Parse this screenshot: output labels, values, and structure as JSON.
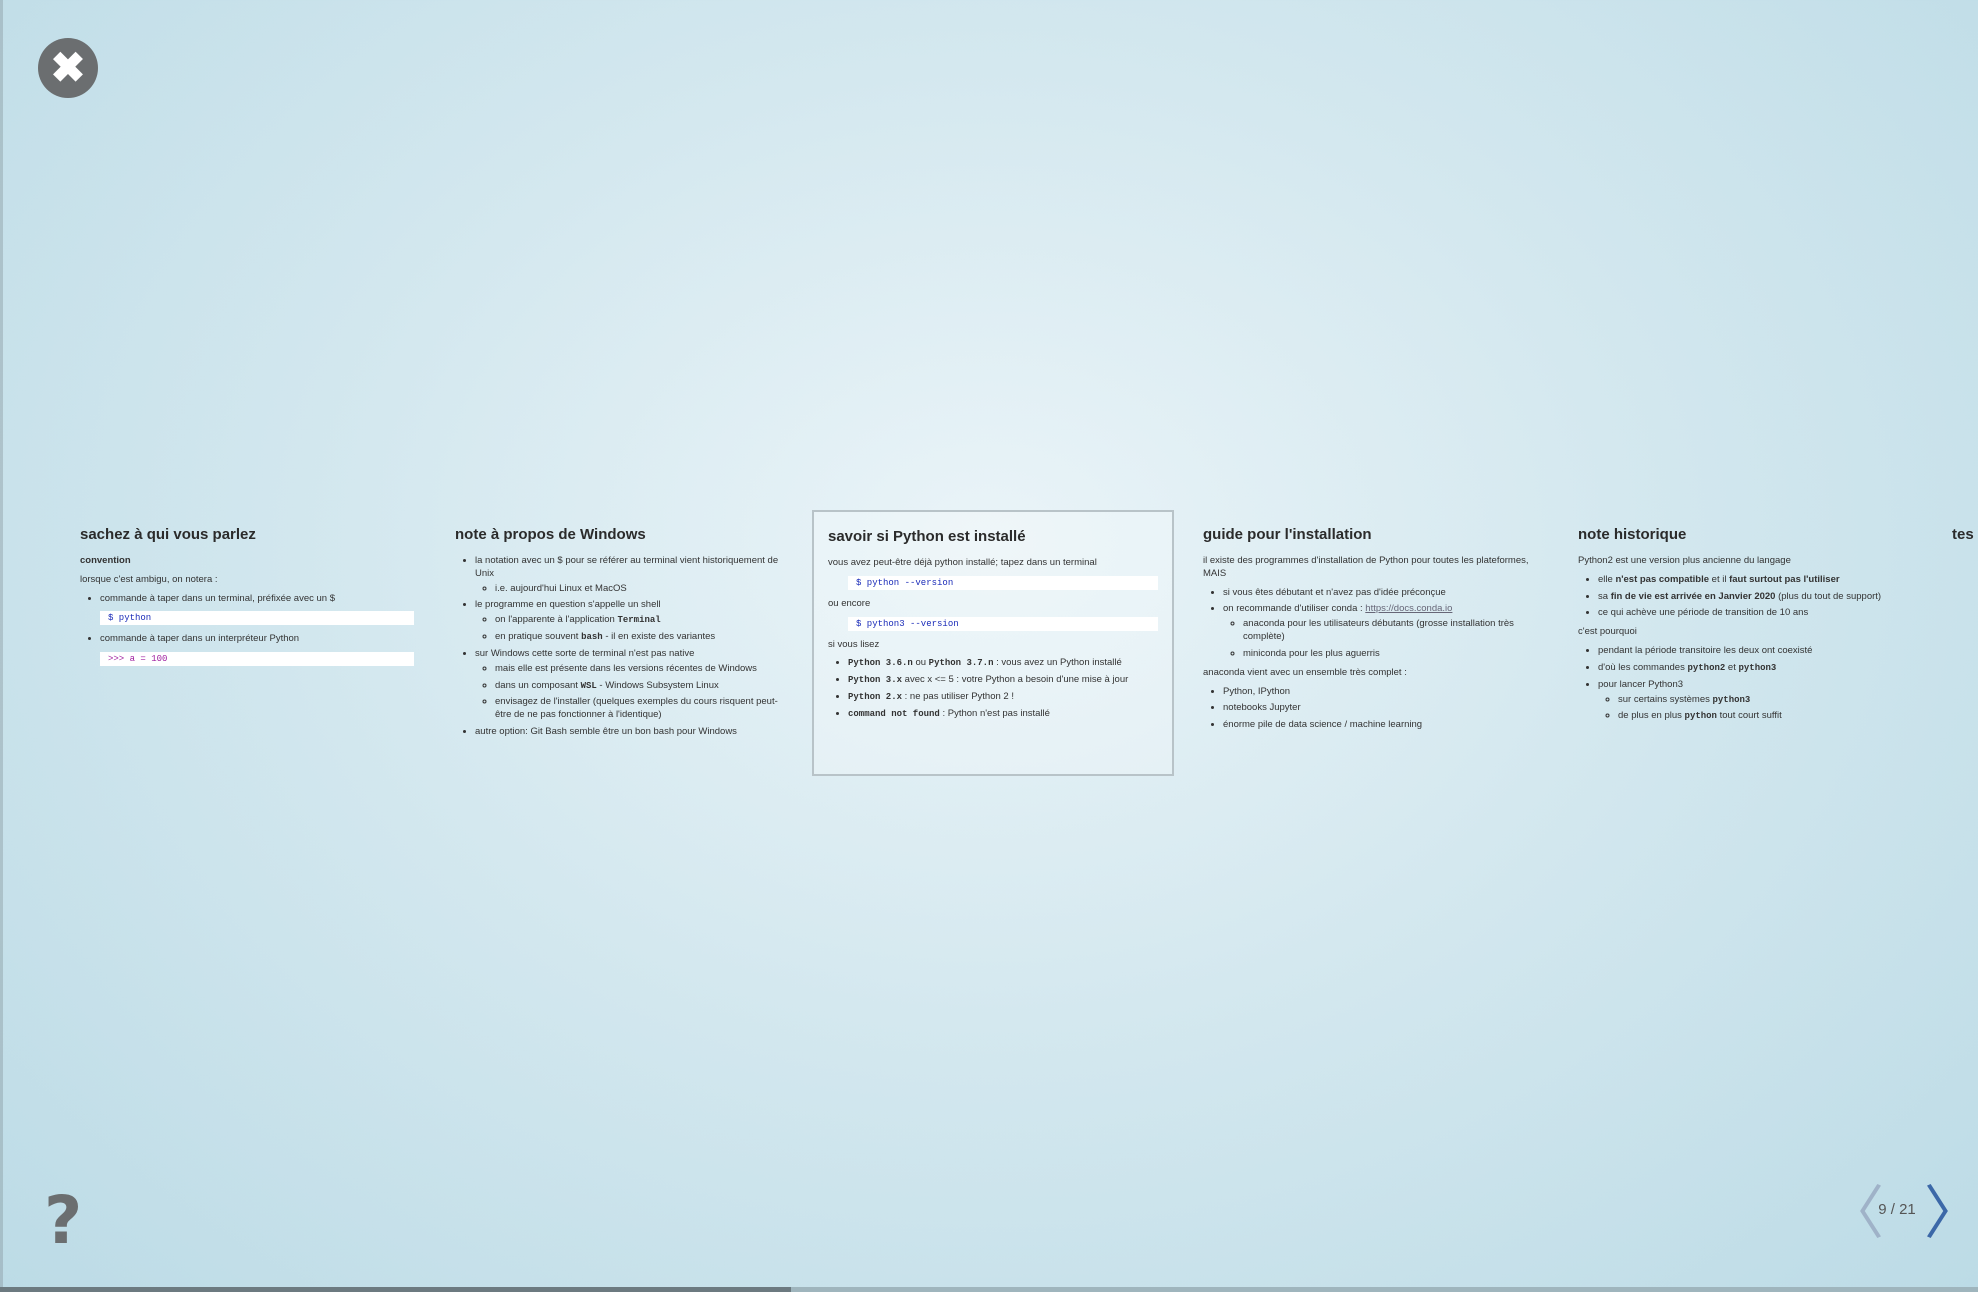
{
  "controls": {
    "close_glyph": "✖",
    "help_glyph": "?",
    "prev_glyph": "〈",
    "next_glyph": "〉",
    "counter": "9 / 21",
    "progress": 0.4
  },
  "slides": [
    {
      "title": "sachez à qui vous parlez",
      "subtitle": "convention",
      "intro": "lorsque c'est ambigu, on notera :",
      "item1": "commande à taper dans un terminal, préfixée avec un $",
      "code1": "$ python",
      "item2": "commande à taper dans un interpréteur Python",
      "code2": ">>> a = 100"
    },
    {
      "title": "note à propos de Windows",
      "b1": "la notation avec un $ pour se référer au terminal vient historiquement de Unix",
      "b1a": "i.e. aujourd'hui Linux et MacOS",
      "b2": "le programme en question s'appelle un shell",
      "b2a_pre": "on l'apparente à l'application ",
      "b2a_code": "Terminal",
      "b2b_pre": "en pratique souvent ",
      "b2b_code": "bash",
      "b2b_post": " - il en existe des variantes",
      "b3": "sur Windows cette sorte de terminal n'est pas native",
      "b3a": "mais elle est présente dans les versions récentes de Windows",
      "b3b_pre": "dans un composant ",
      "b3b_code": "WSL",
      "b3b_post": " - Windows Subsystem Linux",
      "b3c": "envisagez de l'installer (quelques exemples du cours risquent peut-être de ne pas fonctionner à l'identique)",
      "b4": "autre option: Git Bash semble être un bon bash pour Windows"
    },
    {
      "title": "savoir si Python est installé",
      "intro": "vous avez peut-être déjà python installé; tapez dans un terminal",
      "code1": "$ python --version",
      "or": "ou encore",
      "code2": "$ python3 --version",
      "if": "si vous lisez",
      "l1_c1": "Python 3.6.n",
      "l1_mid": " ou ",
      "l1_c2": "Python 3.7.n",
      "l1_post": " : vous avez un Python installé",
      "l2_c": "Python 3.x",
      "l2_post": " avec x <= 5 : votre Python a besoin d'une mise à jour",
      "l3_c": "Python 2.x",
      "l3_post": " : ne pas utiliser Python 2 !",
      "l4_c": "command not found",
      "l4_post": " : Python n'est pas installé"
    },
    {
      "title": "guide pour l'installation",
      "intro": "il existe des programmes d'installation de Python pour toutes les plateformes, MAIS",
      "b1": "si vous êtes débutant et n'avez pas d'idée préconçue",
      "b2_pre": "on recommande d'utiliser conda : ",
      "b2_link": "https://docs.conda.io",
      "b2a": "anaconda pour les utilisateurs débutants (grosse installation très complète)",
      "b2b": "miniconda pour les plus aguerris",
      "p2": "anaconda vient avec un ensemble très complet :",
      "c1": "Python, IPython",
      "c2": "notebooks Jupyter",
      "c3": "énorme pile de data science / machine learning"
    },
    {
      "title": "note historique",
      "intro": "Python2 est une version plus ancienne du langage",
      "b1_pre": "elle ",
      "b1_b1": "n'est pas compatible",
      "b1_mid": " et il ",
      "b1_b2": "faut surtout pas l'utiliser",
      "b2_pre": "sa ",
      "b2_b": "fin de vie est arrivée en Janvier 2020",
      "b2_post": " (plus du tout de support)",
      "b3": "ce qui achève une période de transition de 10 ans",
      "p2": "c'est pourquoi",
      "c1": "pendant la période transitoire les deux ont coexisté",
      "c2_pre": "d'où les commandes ",
      "c2_code1": "python2",
      "c2_mid": " et ",
      "c2_code2": "python3",
      "c3": "pour lancer Python3",
      "c3a_pre": "sur certains systèmes ",
      "c3a_code": "python3",
      "c3b_pre": "de plus en plus ",
      "c3b_code": "python",
      "c3b_post": " tout court suffit"
    },
    {
      "title": "tes"
    }
  ]
}
